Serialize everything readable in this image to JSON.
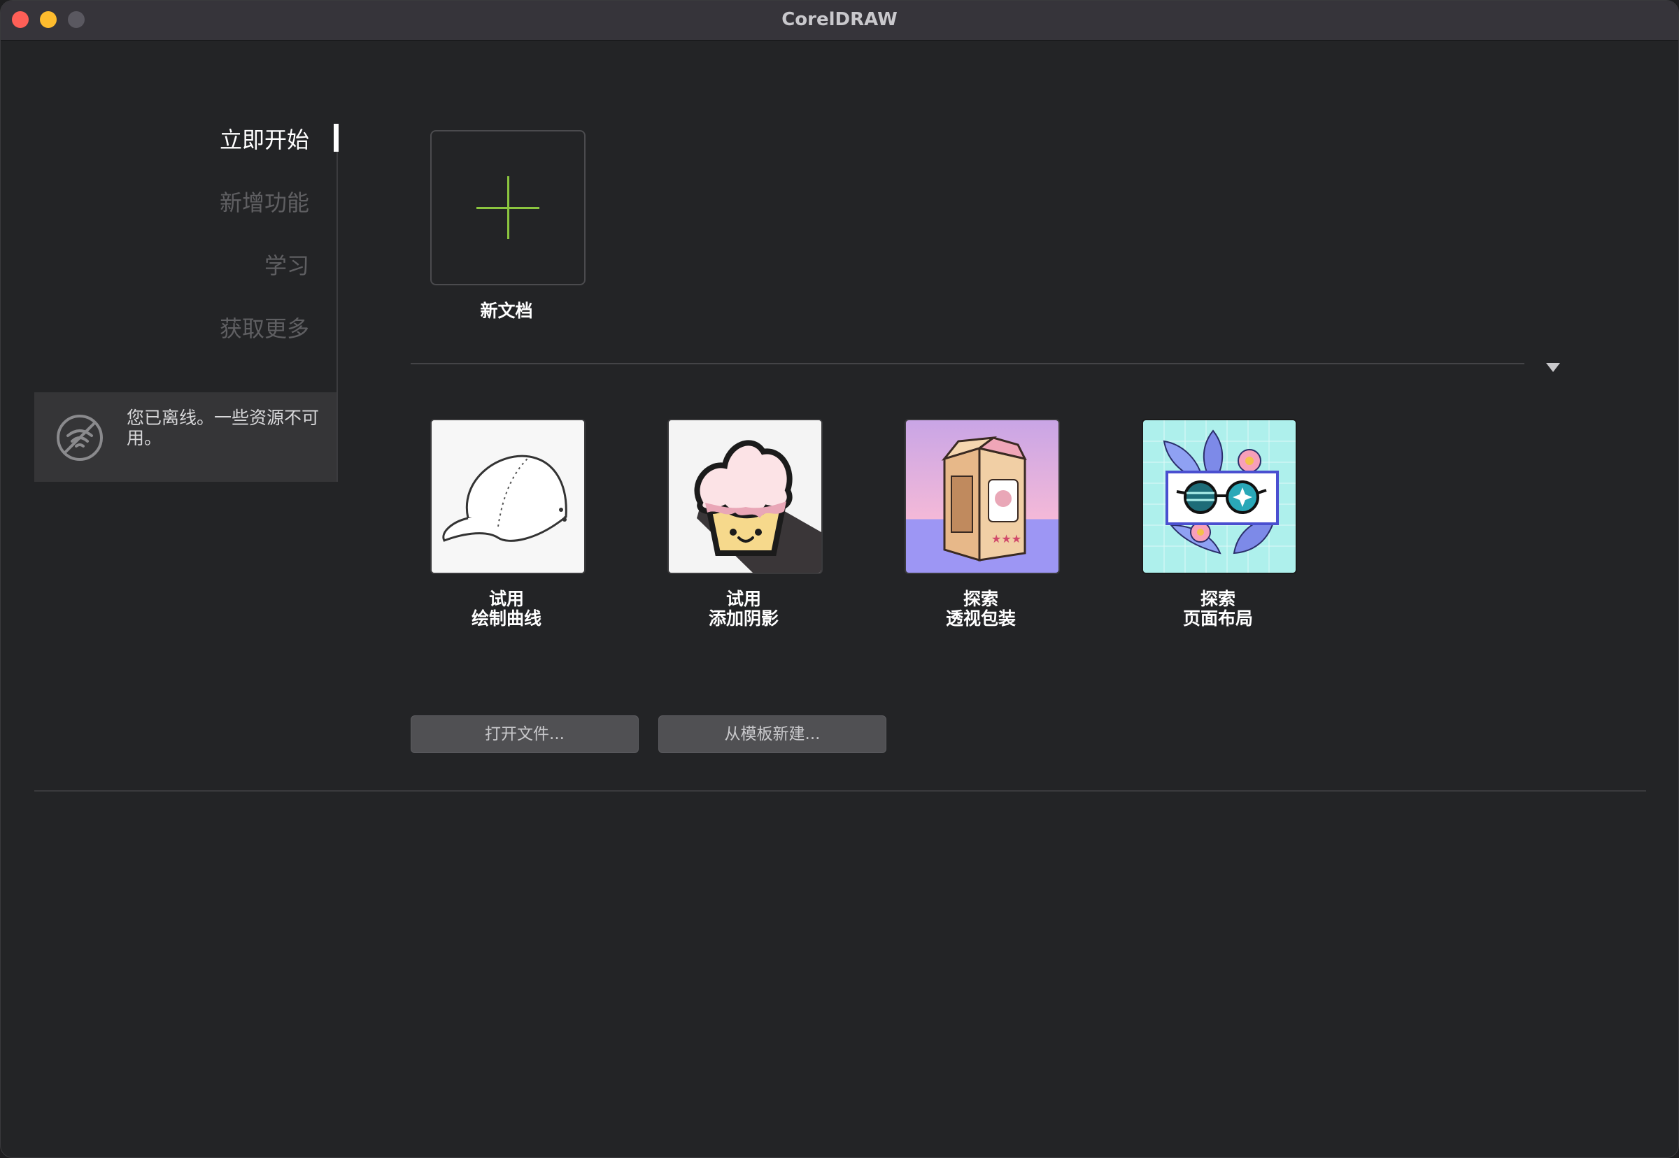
{
  "window": {
    "title": "CorelDRAW"
  },
  "sidebar": {
    "items": [
      {
        "label": "立即开始",
        "active": true
      },
      {
        "label": "新增功能",
        "active": false
      },
      {
        "label": "学习",
        "active": false
      },
      {
        "label": "获取更多",
        "active": false
      }
    ],
    "offline_message": "您已离线。一些资源不可用。"
  },
  "main": {
    "new_document_label": "新文档",
    "tiles": [
      {
        "line1": "试用",
        "line2": "绘制曲线",
        "icon": "baseball-cap"
      },
      {
        "line1": "试用",
        "line2": "添加阴影",
        "icon": "cupcake"
      },
      {
        "line1": "探索",
        "line2": "透视包装",
        "icon": "milk-carton-box"
      },
      {
        "line1": "探索",
        "line2": "页面布局",
        "icon": "sunglasses-flowers"
      }
    ],
    "open_file_button": "打开文件...",
    "new_from_template_button": "从模板新建..."
  },
  "colors": {
    "accent_green": "#8bc53f",
    "background": "#232426",
    "titlebar": "#36343a"
  }
}
